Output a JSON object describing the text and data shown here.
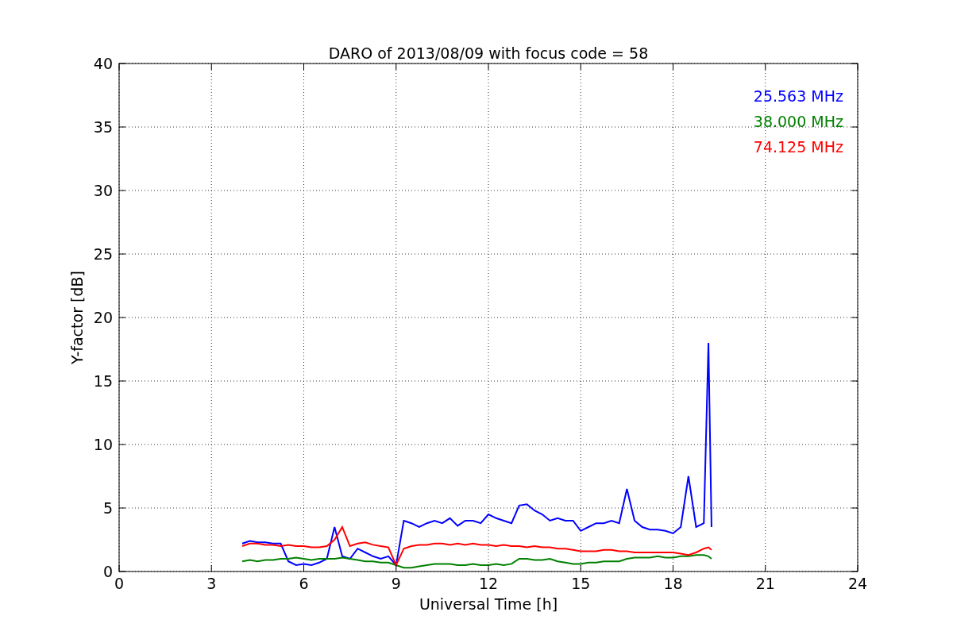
{
  "figure": {
    "chart_data": {
      "type": "line",
      "grid": true,
      "title": "DARO of 2013/08/09 with focus code = 58",
      "xlabel": "Universal Time [h]",
      "ylabel": "Y-factor [dB]",
      "xlim": [
        0,
        24
      ],
      "ylim": [
        0,
        40
      ],
      "xticks": [
        0,
        3,
        6,
        9,
        12,
        15,
        18,
        21,
        24
      ],
      "yticks": [
        0,
        5,
        10,
        15,
        20,
        25,
        30,
        35,
        40
      ],
      "x": [
        4,
        4.25,
        4.5,
        4.75,
        5,
        5.25,
        5.5,
        5.75,
        6,
        6.25,
        6.5,
        6.75,
        7,
        7.25,
        7.5,
        7.75,
        8,
        8.25,
        8.5,
        8.75,
        9,
        9.25,
        9.5,
        9.75,
        10,
        10.25,
        10.5,
        10.75,
        11,
        11.25,
        11.5,
        11.75,
        12,
        12.25,
        12.5,
        12.75,
        13,
        13.25,
        13.5,
        13.75,
        14,
        14.25,
        14.5,
        14.75,
        15,
        15.25,
        15.5,
        15.75,
        16,
        16.25,
        16.5,
        16.75,
        17,
        17.25,
        17.5,
        17.75,
        18,
        18.25,
        18.5,
        18.75,
        19,
        19.15,
        19.25
      ],
      "series": [
        {
          "name": "25.563 MHz",
          "color": "#0000ff",
          "values": [
            2.2,
            2.4,
            2.3,
            2.3,
            2.2,
            2.2,
            0.8,
            0.5,
            0.6,
            0.5,
            0.7,
            1.0,
            3.5,
            1.2,
            1.0,
            1.8,
            1.5,
            1.2,
            1.0,
            1.2,
            0.5,
            4.0,
            3.8,
            3.5,
            3.8,
            4.0,
            3.8,
            4.2,
            3.6,
            4.0,
            4.0,
            3.8,
            4.5,
            4.2,
            4.0,
            3.8,
            5.2,
            5.3,
            4.8,
            4.5,
            4.0,
            4.2,
            4.0,
            4.0,
            3.2,
            3.5,
            3.8,
            3.8,
            4.0,
            3.8,
            6.5,
            4.0,
            3.5,
            3.3,
            3.3,
            3.2,
            3.0,
            3.5,
            7.5,
            3.5,
            3.8,
            18.0,
            3.5
          ]
        },
        {
          "name": "38.000 MHz",
          "color": "#008000",
          "values": [
            0.8,
            0.9,
            0.8,
            0.9,
            0.9,
            1.0,
            1.0,
            1.1,
            1.0,
            0.9,
            1.0,
            1.0,
            1.0,
            1.1,
            1.0,
            0.9,
            0.8,
            0.8,
            0.7,
            0.7,
            0.5,
            0.3,
            0.3,
            0.4,
            0.5,
            0.6,
            0.6,
            0.6,
            0.5,
            0.5,
            0.6,
            0.5,
            0.5,
            0.6,
            0.5,
            0.6,
            1.0,
            1.0,
            0.9,
            0.9,
            1.0,
            0.8,
            0.7,
            0.6,
            0.6,
            0.7,
            0.7,
            0.8,
            0.8,
            0.8,
            1.0,
            1.1,
            1.1,
            1.1,
            1.2,
            1.1,
            1.1,
            1.2,
            1.2,
            1.3,
            1.3,
            1.2,
            1.0
          ]
        },
        {
          "name": "74.125 MHz",
          "color": "#ff0000",
          "values": [
            2.0,
            2.2,
            2.2,
            2.1,
            2.1,
            2.0,
            2.1,
            2.0,
            2.0,
            1.9,
            1.9,
            2.0,
            2.5,
            3.5,
            2.0,
            2.2,
            2.3,
            2.1,
            2.0,
            1.9,
            0.5,
            1.8,
            2.0,
            2.1,
            2.1,
            2.2,
            2.2,
            2.1,
            2.2,
            2.1,
            2.2,
            2.1,
            2.1,
            2.0,
            2.1,
            2.0,
            2.0,
            1.9,
            2.0,
            1.9,
            1.9,
            1.8,
            1.8,
            1.7,
            1.6,
            1.6,
            1.6,
            1.7,
            1.7,
            1.6,
            1.6,
            1.5,
            1.5,
            1.5,
            1.5,
            1.5,
            1.5,
            1.4,
            1.3,
            1.5,
            1.8,
            1.9,
            1.7
          ]
        }
      ]
    }
  }
}
